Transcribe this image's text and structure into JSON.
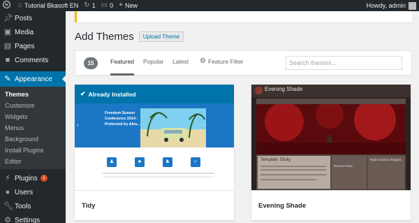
{
  "admin_bar": {
    "site_name": "Tutorial Bkasoft EN",
    "updates_count": "1",
    "comments_count": "0",
    "new_label": "New",
    "howdy": "Howdy, admin"
  },
  "sidebar": {
    "items": [
      {
        "label": "Posts",
        "icon": "pin-icon"
      },
      {
        "label": "Media",
        "icon": "media-icon"
      },
      {
        "label": "Pages",
        "icon": "page-icon"
      },
      {
        "label": "Comments",
        "icon": "comment-icon"
      },
      {
        "label": "Appearance",
        "icon": "brush-icon"
      },
      {
        "label": "Plugins",
        "icon": "plug-icon",
        "badge": "1"
      },
      {
        "label": "Users",
        "icon": "user-icon"
      },
      {
        "label": "Tools",
        "icon": "wrench-icon"
      },
      {
        "label": "Settings",
        "icon": "settings-icon"
      }
    ],
    "submenu": [
      "Themes",
      "Customize",
      "Widgets",
      "Menus",
      "Background",
      "Install Plugins",
      "Editor"
    ]
  },
  "page": {
    "title": "Add Themes",
    "upload_button": "Upload Theme"
  },
  "filter": {
    "count": "15",
    "tabs": [
      "Featured",
      "Popular",
      "Latest"
    ],
    "feature_filter": "Feature Filter",
    "search_placeholder": "Search themes..."
  },
  "themes": [
    {
      "name": "Tidy",
      "installed_label": "Already Installed",
      "preview": {
        "hero_text": "Freedom Sunset Conference 2014 - Protected by Akis...",
        "tile_icons": [
          "person",
          "tree",
          "people",
          "thumb"
        ]
      }
    },
    {
      "name": "Evening Shade",
      "preview": {
        "site_title": "Evening Shade",
        "post_title": "Template: Sticky",
        "sidebar_title": "Right Column Widgets",
        "recent_posts": "Recent Posts"
      }
    }
  ],
  "colors": {
    "admin_dark": "#23282d",
    "accent_blue": "#0073aa",
    "badge_orange": "#d54e21"
  }
}
